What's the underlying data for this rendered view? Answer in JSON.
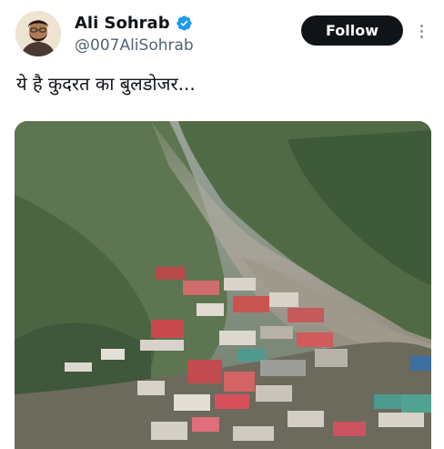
{
  "author": {
    "name": "Ali Sohrab",
    "handle": "@007AliSohrab",
    "verified": true,
    "verified_color": "#1d9bf0"
  },
  "actions": {
    "follow_label": "Follow"
  },
  "tweet": {
    "text": "ये है कुदरत का बुलडोजर..."
  },
  "media": {
    "kind": "photo",
    "description_icon": "landslide-photo"
  },
  "colors": {
    "follow_bg": "#0f1419",
    "text_primary": "#0f1419",
    "text_secondary": "#536471"
  }
}
